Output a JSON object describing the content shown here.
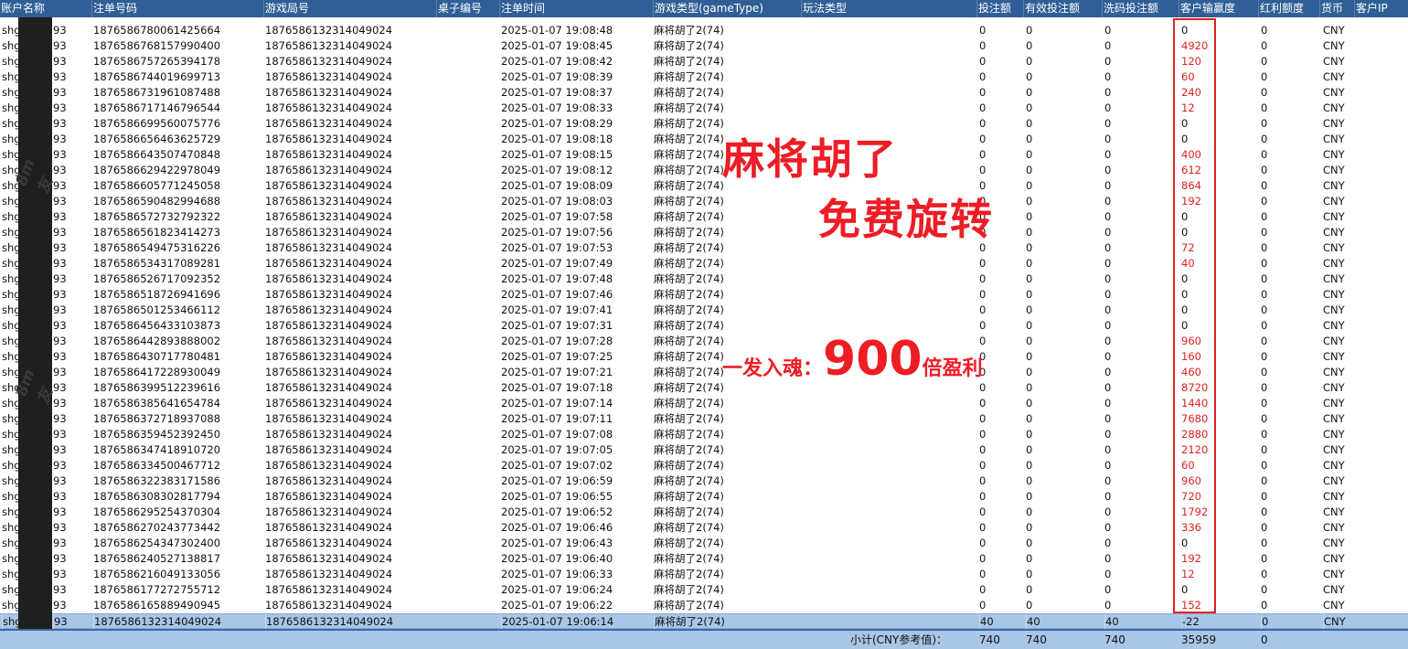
{
  "columns": [
    "账户名称",
    "注单号码",
    "游戏局号",
    "桌子编号",
    "注单时间",
    "游戏类型(gameType)",
    "玩法类型",
    "投注额",
    "有效投注额",
    "洗码投注额",
    "客户输赢度",
    "红利额度",
    "货币",
    "客户IP"
  ],
  "account_prefix": "shg",
  "account_suffix": "93",
  "game_round": "187658613231404902​4",
  "game_type": "麻将胡了2(74)",
  "currency": "CNY",
  "rows": [
    {
      "bet_no": "1876586780061425664",
      "time": "2025-01-07 19:08:48",
      "payout": "0"
    },
    {
      "bet_no": "1876586768157990400",
      "time": "2025-01-07 19:08:45",
      "payout": "4920"
    },
    {
      "bet_no": "1876586757265394178",
      "time": "2025-01-07 19:08:42",
      "payout": "120"
    },
    {
      "bet_no": "1876586744019699713",
      "time": "2025-01-07 19:08:39",
      "payout": "60"
    },
    {
      "bet_no": "1876586731961087488",
      "time": "2025-01-07 19:08:37",
      "payout": "240"
    },
    {
      "bet_no": "1876586717146796544",
      "time": "2025-01-07 19:08:33",
      "payout": "12"
    },
    {
      "bet_no": "1876586699560075776",
      "time": "2025-01-07 19:08:29",
      "payout": "0"
    },
    {
      "bet_no": "1876586656463625729",
      "time": "2025-01-07 19:08:18",
      "payout": "0"
    },
    {
      "bet_no": "1876586643507470848",
      "time": "2025-01-07 19:08:15",
      "payout": "400"
    },
    {
      "bet_no": "1876586629422978049",
      "time": "2025-01-07 19:08:12",
      "payout": "612"
    },
    {
      "bet_no": "1876586605771245058",
      "time": "2025-01-07 19:08:09",
      "payout": "864"
    },
    {
      "bet_no": "1876586590482994688",
      "time": "2025-01-07 19:08:03",
      "payout": "192"
    },
    {
      "bet_no": "1876586572732792322",
      "time": "2025-01-07 19:07:58",
      "payout": "0"
    },
    {
      "bet_no": "1876586561823414273",
      "time": "2025-01-07 19:07:56",
      "payout": "0"
    },
    {
      "bet_no": "1876586549475316226",
      "time": "2025-01-07 19:07:53",
      "payout": "72"
    },
    {
      "bet_no": "1876586534317089281",
      "time": "2025-01-07 19:07:49",
      "payout": "40"
    },
    {
      "bet_no": "1876586526717092352",
      "time": "2025-01-07 19:07:48",
      "payout": "0"
    },
    {
      "bet_no": "1876586518726941696",
      "time": "2025-01-07 19:07:46",
      "payout": "0"
    },
    {
      "bet_no": "1876586501253466112",
      "time": "2025-01-07 19:07:41",
      "payout": "0"
    },
    {
      "bet_no": "1876586456433103873",
      "time": "2025-01-07 19:07:31",
      "payout": "0"
    },
    {
      "bet_no": "1876586442893888002",
      "time": "2025-01-07 19:07:28",
      "payout": "960"
    },
    {
      "bet_no": "1876586430717780481",
      "time": "2025-01-07 19:07:25",
      "payout": "160"
    },
    {
      "bet_no": "1876586417228930049",
      "time": "2025-01-07 19:07:21",
      "payout": "460"
    },
    {
      "bet_no": "1876586399512239616",
      "time": "2025-01-07 19:07:18",
      "payout": "8720"
    },
    {
      "bet_no": "1876586385641654784",
      "time": "2025-01-07 19:07:14",
      "payout": "1440"
    },
    {
      "bet_no": "1876586372718937088",
      "time": "2025-01-07 19:07:11",
      "payout": "7680"
    },
    {
      "bet_no": "1876586359452392450",
      "time": "2025-01-07 19:07:08",
      "payout": "2880"
    },
    {
      "bet_no": "1876586347418910720",
      "time": "2025-01-07 19:07:05",
      "payout": "2120"
    },
    {
      "bet_no": "1876586334500467712",
      "time": "2025-01-07 19:07:02",
      "payout": "60"
    },
    {
      "bet_no": "1876586322383171586",
      "time": "2025-01-07 19:06:59",
      "payout": "960"
    },
    {
      "bet_no": "1876586308302817794",
      "time": "2025-01-07 19:06:55",
      "payout": "720"
    },
    {
      "bet_no": "1876586295254370304",
      "time": "2025-01-07 19:06:52",
      "payout": "1792"
    },
    {
      "bet_no": "1876586270243773442",
      "time": "2025-01-07 19:06:46",
      "payout": "336"
    },
    {
      "bet_no": "1876586254347302400",
      "time": "2025-01-07 19:06:43",
      "payout": "0"
    },
    {
      "bet_no": "1876586240527138817",
      "time": "2025-01-07 19:06:40",
      "payout": "192"
    },
    {
      "bet_no": "1876586216049133056",
      "time": "2025-01-07 19:06:33",
      "payout": "12"
    },
    {
      "bet_no": "1876586177272755712",
      "time": "2025-01-07 19:06:24",
      "payout": "0"
    },
    {
      "bet_no": "1876586165889490945",
      "time": "2025-01-07 19:06:22",
      "payout": "152"
    }
  ],
  "bet_default": "0",
  "selected_row": {
    "bet_no": "1876586132314049024",
    "time": "2025-01-07 19:06:14",
    "bet": "40",
    "valid_bet": "40",
    "wash_bet": "40",
    "payout": "-22",
    "bonus": "0"
  },
  "subtotal": {
    "label": "小计(CNY参考值)：",
    "bet": "740",
    "valid_bet": "740",
    "wash_bet": "740",
    "payout": "35959",
    "bonus": "0"
  },
  "annotations": {
    "line1": "麻将胡了",
    "line2": "免费旋转",
    "line3_prefix": "一发入魂：",
    "line3_number": "900",
    "line3_suffix": "倍盈利"
  },
  "watermark": "8m友",
  "colors": {
    "header": "#2f5f96",
    "highlight": "#a9c6e6",
    "accent_red": "#ee1c25",
    "payout_red": "#e02020"
  }
}
